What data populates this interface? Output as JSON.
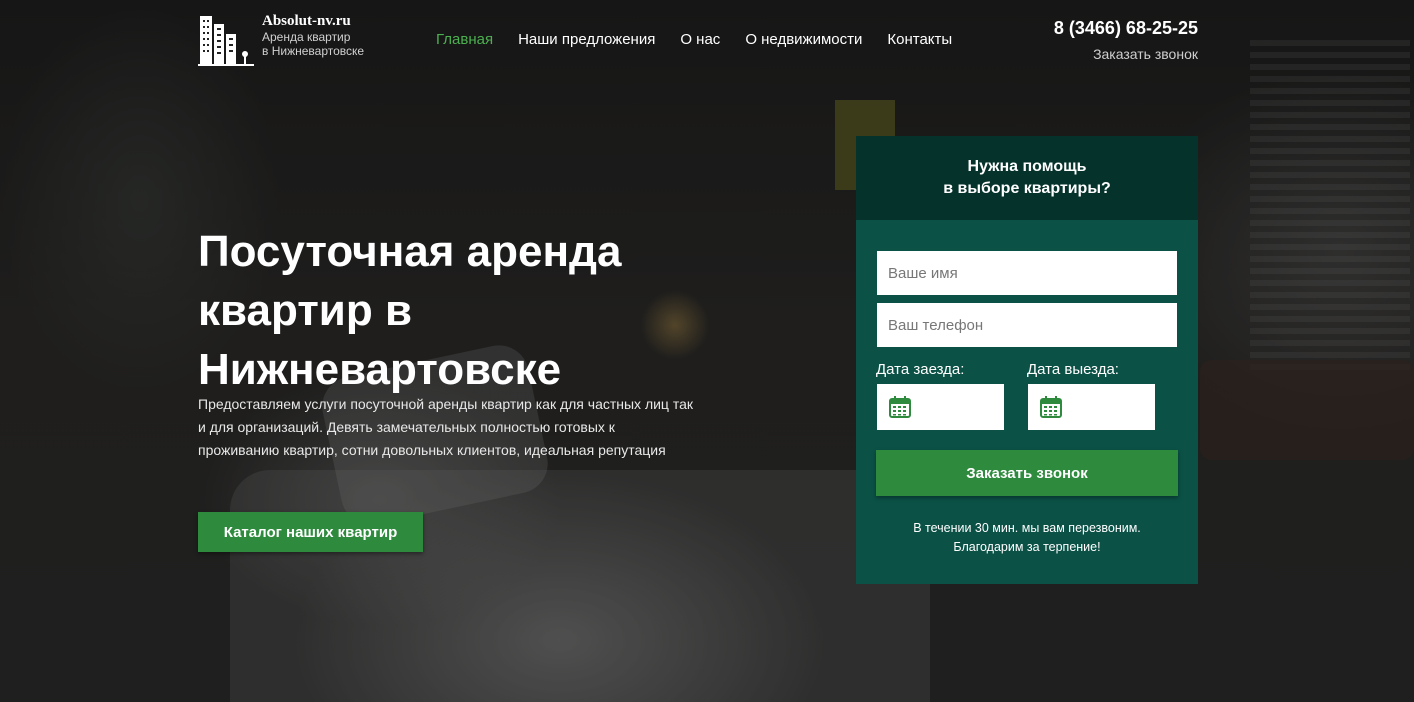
{
  "logo": {
    "name": "Absolut-nv.ru",
    "subtitle_line1": "Аренда квартир",
    "subtitle_line2": "в Нижневартовске"
  },
  "nav": {
    "items": [
      {
        "label": "Главная",
        "active": true
      },
      {
        "label": "Наши предложения",
        "active": false
      },
      {
        "label": "О нас",
        "active": false
      },
      {
        "label": "О недвижимости",
        "active": false
      },
      {
        "label": "Контакты",
        "active": false
      }
    ]
  },
  "contact": {
    "phone": "8 (3466) 68-25-25",
    "callback_label": "Заказать звонок"
  },
  "hero": {
    "title": "Посуточная аренда квартир в Нижневартовске",
    "description": "Предоставляем услуги посуточной аренды квартир как для частных лиц так и для организаций. Девять замечательных полностью готовых к проживанию квартир, сотни довольных клиентов, идеальная репутация",
    "catalog_button": "Каталог наших квартир"
  },
  "form": {
    "title_line1": "Нужна помощь",
    "title_line2": "в выборе квартиры?",
    "name_placeholder": "Ваше имя",
    "phone_placeholder": "Ваш телефон",
    "checkin_label": "Дата заезда:",
    "checkout_label": "Дата выезда:",
    "calendar_icon": "calendar-icon",
    "submit_label": "Заказать звонок",
    "note_line1": "В течении 30 мин. мы вам перезвоним.",
    "note_line2": "Благодарим за терпение!"
  },
  "colors": {
    "accent_green": "#2e8b3e",
    "active_nav": "#4caf50",
    "panel_bg": "#0b5146",
    "panel_header_bg": "#05332c"
  }
}
